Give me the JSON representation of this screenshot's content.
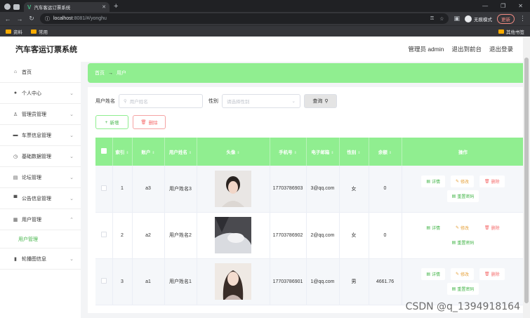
{
  "browser": {
    "tab_title": "汽车客运订票系统",
    "url_host": "localhost",
    "url_path": ":8081/#/yonghu",
    "profile_label": "无痕模式",
    "update_label": "更新",
    "bookmarks": [
      "资料",
      "常用"
    ],
    "bookmarks_right": "其他书签"
  },
  "header": {
    "title": "汽车客运订票系统",
    "admin": "管理员 admin",
    "front": "退出到前台",
    "logout": "退出登录"
  },
  "sidebar": {
    "items": [
      {
        "label": "首页",
        "icon": "home-icon"
      },
      {
        "label": "个人中心",
        "icon": "user-icon"
      },
      {
        "label": "管理员管理",
        "icon": "admin-icon"
      },
      {
        "label": "车票信息管理",
        "icon": "monitor-icon"
      },
      {
        "label": "基础数据管理",
        "icon": "clock-icon"
      },
      {
        "label": "论坛管理",
        "icon": "forum-icon"
      },
      {
        "label": "公告信息管理",
        "icon": "notice-icon"
      },
      {
        "label": "用户管理",
        "icon": "grid-icon"
      },
      {
        "label": "轮播图信息",
        "icon": "chart-icon"
      }
    ],
    "submenu": "用户管理"
  },
  "breadcrumb": {
    "home": "首页",
    "current": "用户"
  },
  "search": {
    "name_label": "用户姓名",
    "name_placeholder": "用户姓名",
    "gender_label": "性别",
    "gender_placeholder": "请选择性别",
    "button": "查询"
  },
  "actions": {
    "add": "新增",
    "delete": "删除"
  },
  "table": {
    "headers": [
      "索引",
      "账户",
      "用户姓名",
      "头像",
      "手机号",
      "电子邮箱",
      "性别",
      "余额",
      "操作"
    ],
    "rows": [
      {
        "index": "1",
        "account": "a3",
        "name": "用户姓名3",
        "phone": "17703786903",
        "email": "3@qq.com",
        "gender": "女",
        "balance": "0"
      },
      {
        "index": "2",
        "account": "a2",
        "name": "用户姓名2",
        "phone": "17703786902",
        "email": "2@qq.com",
        "gender": "女",
        "balance": "0"
      },
      {
        "index": "3",
        "account": "a1",
        "name": "用户姓名1",
        "phone": "17703786901",
        "email": "1@qq.com",
        "gender": "男",
        "balance": "4661.76"
      }
    ],
    "ops": {
      "view": "详情",
      "edit": "修改",
      "del": "删除",
      "reset": "重置密码"
    }
  },
  "watermark": "CSDN @q_1394918164",
  "colors": {
    "accent": "#90ee90",
    "success": "#44b549",
    "warning": "#e6a23c",
    "danger": "#f56c6c"
  }
}
